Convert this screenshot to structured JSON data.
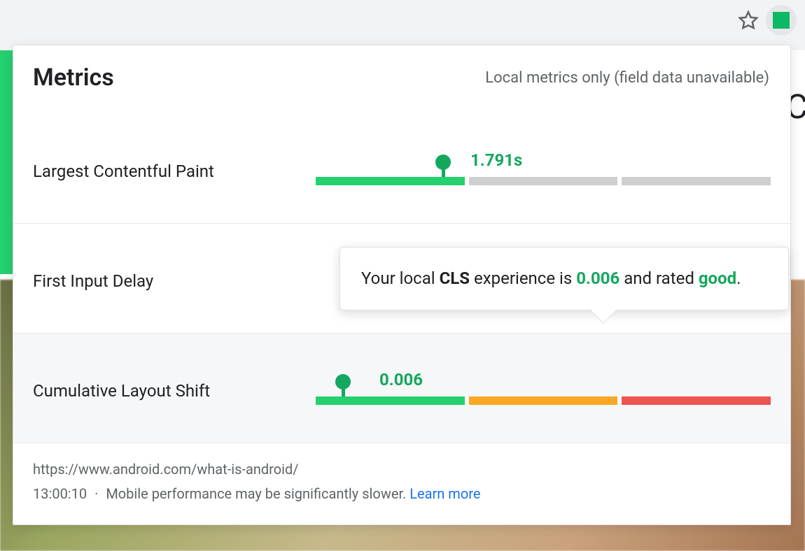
{
  "browser": {
    "extension_color": "#0bb964"
  },
  "header": {
    "title": "Metrics",
    "subtitle": "Local metrics only (field data unavailable)"
  },
  "metrics": [
    {
      "id": "lcp",
      "label": "Largest Contentful Paint",
      "value_display": "1.791s",
      "marker_position_pct": 28,
      "value_label_left_pct": 34,
      "segments": [
        "good",
        "grey",
        "grey"
      ],
      "highlighted": false
    },
    {
      "id": "fid",
      "label": "First Input Delay",
      "value_display": "",
      "marker_position_pct": null,
      "value_label_left_pct": null,
      "segments": [],
      "highlighted": false
    },
    {
      "id": "cls",
      "label": "Cumulative Layout Shift",
      "value_display": "0.006",
      "marker_position_pct": 6,
      "value_label_left_pct": 14,
      "segments": [
        "good",
        "ni",
        "poor"
      ],
      "highlighted": true
    }
  ],
  "tooltip": {
    "prefix": "Your local ",
    "metric_short": "CLS",
    "mid": " experience is ",
    "value": "0.006",
    "mid2": " and rated ",
    "rating": "good",
    "suffix": "."
  },
  "footer": {
    "url": "https://www.android.com/what-is-android/",
    "time": "13:00:10",
    "note": "Mobile performance may be significantly slower.",
    "learn_more": "Learn more"
  },
  "backdrop": {
    "letter": "C"
  }
}
